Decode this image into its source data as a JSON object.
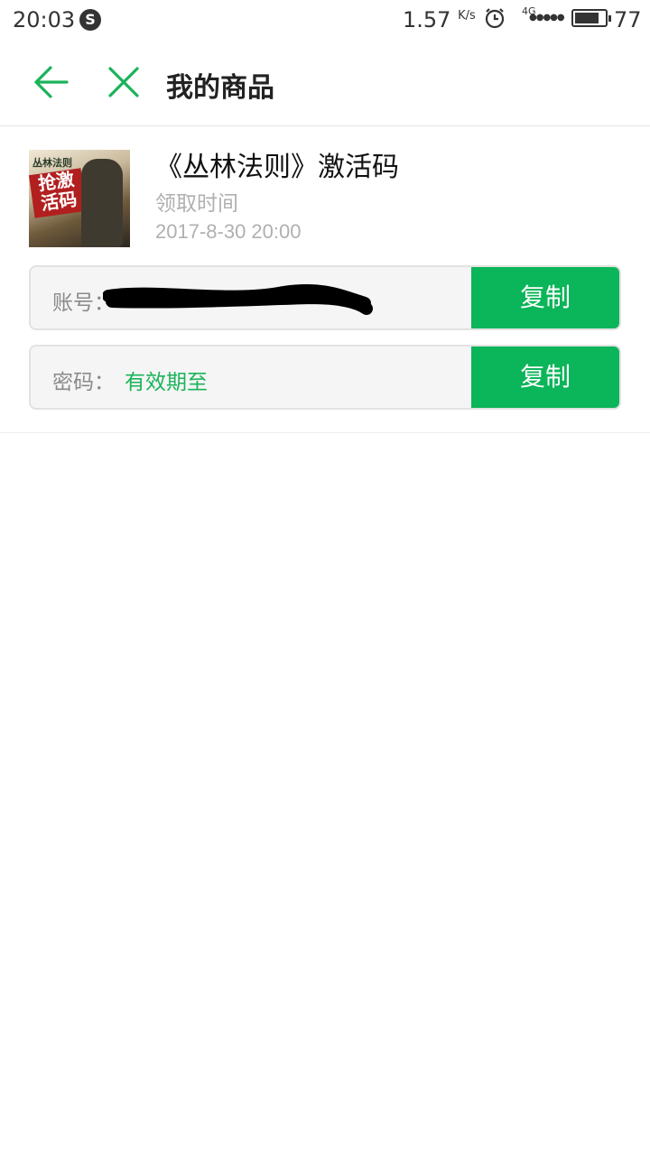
{
  "status_bar": {
    "time": "20:03",
    "speed": "1.57",
    "speed_unit": "K/s",
    "network": "4G",
    "battery": "77"
  },
  "nav": {
    "title": "我的商品"
  },
  "product": {
    "title": "《丛林法则》激活码",
    "time_label": "领取时间",
    "time_value": "2017-8-30 20:00",
    "thumbnail_text_top": "丛林法则",
    "thumbnail_text_main": "抢激活码"
  },
  "fields": {
    "account": {
      "label": "账号：",
      "value": "",
      "copy_label": "复制"
    },
    "password": {
      "label": "密码：",
      "value": "有效期至",
      "copy_label": "复制"
    }
  },
  "colors": {
    "accent": "#0bb559",
    "value_text": "#1ab35a"
  }
}
